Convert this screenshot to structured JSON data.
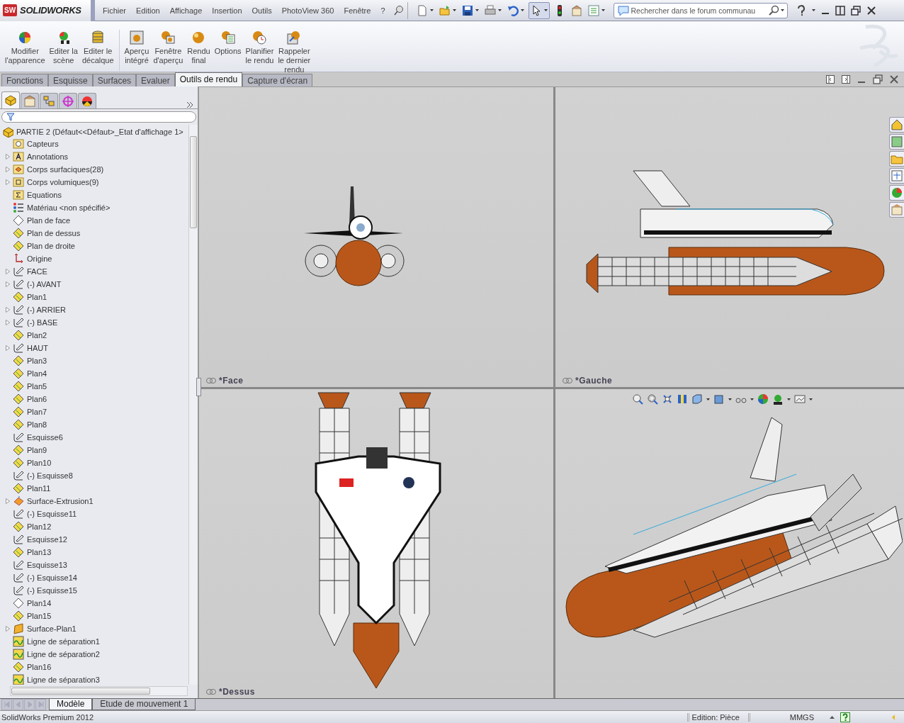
{
  "app": {
    "logo_mark": "SW",
    "logo_text": "SOLIDWORKS"
  },
  "menu": [
    "Fichier",
    "Edition",
    "Affichage",
    "Insertion",
    "Outils",
    "PhotoView 360",
    "Fenêtre",
    "?"
  ],
  "search": {
    "placeholder": "Rechercher dans le forum communau"
  },
  "ribbon": [
    {
      "kind": "appearance",
      "label": "Modifier\nl'apparence"
    },
    {
      "kind": "scene",
      "label": "Editer la\nscène"
    },
    {
      "kind": "decal",
      "label": "Editer le\ndécalque"
    },
    {
      "kind": "preview",
      "label": "Aperçu\nintégré"
    },
    {
      "kind": "preview-window",
      "label": "Fenêtre\nd'aperçu"
    },
    {
      "kind": "render",
      "label": "Rendu\nfinal"
    },
    {
      "kind": "options",
      "label": "Options"
    },
    {
      "kind": "schedule",
      "label": "Planifier\nle rendu"
    },
    {
      "kind": "recall",
      "label": "Rappeler\nle dernier\nrendu"
    }
  ],
  "command_tabs": [
    {
      "label": "Fonctions",
      "selected": false
    },
    {
      "label": "Esquisse",
      "selected": false
    },
    {
      "label": "Surfaces",
      "selected": false
    },
    {
      "label": "Evaluer",
      "selected": false
    },
    {
      "label": "Outils de rendu",
      "selected": true
    },
    {
      "label": "Capture d'écran",
      "selected": false
    }
  ],
  "panel_tabs": [
    {
      "kind": "feature-tree",
      "selected": true
    },
    {
      "kind": "property",
      "selected": false
    },
    {
      "kind": "configuration",
      "selected": false
    },
    {
      "kind": "dimxpert",
      "selected": false
    },
    {
      "kind": "display",
      "selected": false
    }
  ],
  "tree": {
    "root": "PARTIE 2  (Défaut<<Défaut>_Etat d'affichage 1>",
    "items": [
      {
        "label": "Capteurs",
        "kind": "sensor",
        "expandable": false
      },
      {
        "label": "Annotations",
        "kind": "annotation",
        "expandable": true
      },
      {
        "label": "Corps surfaciques(28)",
        "kind": "surface-bodies",
        "expandable": true
      },
      {
        "label": "Corps volumiques(9)",
        "kind": "solid-bodies",
        "expandable": true
      },
      {
        "label": "Equations",
        "kind": "equation",
        "expandable": false
      },
      {
        "label": "Matériau <non spécifié>",
        "kind": "material",
        "expandable": false
      },
      {
        "label": "Plan de face",
        "kind": "plane-outline",
        "expandable": false
      },
      {
        "label": "Plan de dessus",
        "kind": "plane",
        "expandable": false
      },
      {
        "label": "Plan de droite",
        "kind": "plane",
        "expandable": false
      },
      {
        "label": "Origine",
        "kind": "origin",
        "expandable": false
      },
      {
        "label": "FACE",
        "kind": "sketch",
        "expandable": true
      },
      {
        "label": "(-) AVANT",
        "kind": "sketch",
        "expandable": true
      },
      {
        "label": "Plan1",
        "kind": "plane",
        "expandable": false
      },
      {
        "label": "(-) ARRIER",
        "kind": "sketch",
        "expandable": true
      },
      {
        "label": "(-) BASE",
        "kind": "sketch",
        "expandable": true
      },
      {
        "label": "Plan2",
        "kind": "plane",
        "expandable": false
      },
      {
        "label": "HAUT",
        "kind": "sketch",
        "expandable": true
      },
      {
        "label": "Plan3",
        "kind": "plane",
        "expandable": false
      },
      {
        "label": "Plan4",
        "kind": "plane",
        "expandable": false
      },
      {
        "label": "Plan5",
        "kind": "plane",
        "expandable": false
      },
      {
        "label": "Plan6",
        "kind": "plane",
        "expandable": false
      },
      {
        "label": "Plan7",
        "kind": "plane",
        "expandable": false
      },
      {
        "label": "Plan8",
        "kind": "plane",
        "expandable": false
      },
      {
        "label": "Esquisse6",
        "kind": "sketch",
        "expandable": false
      },
      {
        "label": "Plan9",
        "kind": "plane",
        "expandable": false
      },
      {
        "label": "Plan10",
        "kind": "plane",
        "expandable": false
      },
      {
        "label": "(-) Esquisse8",
        "kind": "sketch",
        "expandable": false
      },
      {
        "label": "Plan11",
        "kind": "plane",
        "expandable": false
      },
      {
        "label": "Surface-Extrusion1",
        "kind": "extrusion",
        "expandable": true
      },
      {
        "label": "(-) Esquisse11",
        "kind": "sketch",
        "expandable": false
      },
      {
        "label": "Plan12",
        "kind": "plane",
        "expandable": false
      },
      {
        "label": "Esquisse12",
        "kind": "sketch",
        "expandable": false
      },
      {
        "label": "Plan13",
        "kind": "plane",
        "expandable": false
      },
      {
        "label": "Esquisse13",
        "kind": "sketch",
        "expandable": false
      },
      {
        "label": "(-) Esquisse14",
        "kind": "sketch",
        "expandable": false
      },
      {
        "label": "(-) Esquisse15",
        "kind": "sketch",
        "expandable": false
      },
      {
        "label": "Plan14",
        "kind": "plane-outline",
        "expandable": false
      },
      {
        "label": "Plan15",
        "kind": "plane",
        "expandable": false
      },
      {
        "label": "Surface-Plan1",
        "kind": "surface",
        "expandable": true
      },
      {
        "label": "Ligne de séparation1",
        "kind": "split-line",
        "expandable": false
      },
      {
        "label": "Ligne de séparation2",
        "kind": "split-line",
        "expandable": false
      },
      {
        "label": "Plan16",
        "kind": "plane",
        "expandable": false
      },
      {
        "label": "Ligne de séparation3",
        "kind": "split-line",
        "expandable": false
      }
    ]
  },
  "viewports": [
    {
      "label": "*Face",
      "kind": "front"
    },
    {
      "label": "*Gauche",
      "kind": "left"
    },
    {
      "label": "*Dessus",
      "kind": "top"
    },
    {
      "kind": "iso"
    }
  ],
  "bottom_tabs": [
    {
      "label": "Modèle",
      "selected": true
    },
    {
      "label": "Etude de mouvement 1",
      "selected": false
    }
  ],
  "status_bar": {
    "product": "SolidWorks Premium 2012",
    "mode": "Edition: Pièce",
    "units": "MMGS"
  }
}
